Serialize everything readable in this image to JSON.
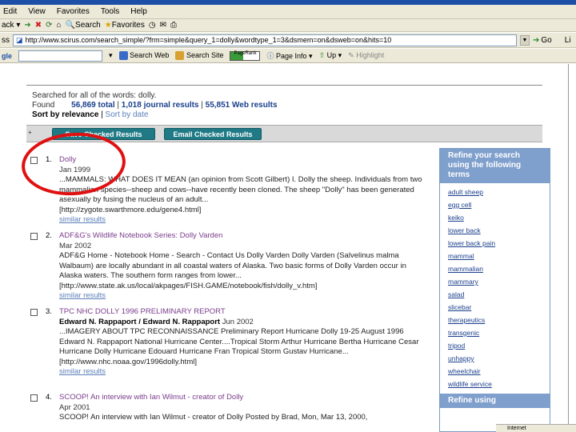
{
  "menu": {
    "items": [
      "Edit",
      "View",
      "Favorites",
      "Tools",
      "Help"
    ]
  },
  "toolbar": {
    "back_label": "ack",
    "search_label": "Search",
    "favorites_label": "Favorites"
  },
  "address": {
    "label": "ss",
    "url": "http://www.scirus.com/search_simple/?frm=simple&query_1=dolly&wordtype_1=3&dsmem=on&dsweb=on&hits=10",
    "go_label": "Go",
    "links_label": "Li"
  },
  "googlebar": {
    "label": "gle",
    "search_web": "Search Web",
    "search_site": "Search Site",
    "pagerank": "PageRank",
    "page_info": "Page Info",
    "up": "Up",
    "highlight": "Highlight"
  },
  "summary": {
    "searched_for": "Searched for all of the words: dolly.",
    "found_prefix": "Found",
    "total": "56,869 total",
    "journal": "1,018 journal results",
    "web": "55,851 Web results",
    "sort_prefix": "Sort by relevance",
    "sort_date": "Sort by date"
  },
  "actions": {
    "marker": "+",
    "save_checked": "Save Checked Results",
    "email_checked": "Email Checked Results"
  },
  "results": [
    {
      "num": "1.",
      "title": "Dolly",
      "date": "Jan 1999",
      "snippet": "...MAMMALS: WHAT DOES IT MEAN (an opinion from Scott Gilbert) I. Dolly the sheep. Individuals from two mammalian species--sheep and cows--have recently been cloned. The sheep \"Dolly\" has been generated asexually by fusing the nucleus of an adult...",
      "url": "[http://zygote.swarthmore.edu/gene4.html]",
      "similar": "similar results"
    },
    {
      "num": "2.",
      "title": "ADF&G's Wildlife Notebook Series: Dolly Varden",
      "date": "Mar 2002",
      "snippet": "ADF&G Home - Notebook Home - Search - Contact Us Dolly Varden Dolly Varden (Salvelinus malma Walbaum) are locally abundant in all coastal waters of Alaska. Two basic forms of Dolly Varden occur in Alaska waters. The southern form ranges from lower...",
      "url": "[http://www.state.ak.us/local/akpages/FISH.GAME/notebook/fish/dolly_v.htm]",
      "similar": "similar results"
    },
    {
      "num": "3.",
      "title": "TPC NHC DOLLY 1996 PRELIMINARY REPORT",
      "authors": "Edward N. Rappaport / Edward N. Rappaport",
      "date": "Jun 2002",
      "snippet": "...IMAGERY ABOUT TPC RECONNAISSANCE Preliminary Report Hurricane Dolly 19-25 August 1996 Edward N. Rappaport National Hurricane Center....Tropical Storm Arthur Hurricane Bertha Hurricane Cesar Hurricane Dolly Hurricane Edouard Hurricane Fran Tropical Storm Gustav Hurricane...",
      "url": "[http://www.nhc.noaa.gov/1996dolly.html]",
      "similar": "similar results"
    },
    {
      "num": "4.",
      "title": "SCOOP! An interview with Ian Wilmut - creator of Dolly",
      "date": "Apr 2001",
      "snippet": "SCOOP! An interview with Ian Wilmut - creator of Dolly Posted by Brad, Mon, Mar 13, 2000,"
    }
  ],
  "refine": {
    "heading": "Refine your search using the following terms",
    "terms": [
      "adult sheep",
      "egg cell",
      "keiko",
      "lower back",
      "lower back pain",
      "mammal",
      "mammalian",
      "mammary",
      "salad",
      "slicebar",
      "therapeutics",
      "transgenic",
      "tripod",
      "unhappy",
      "wheelchair",
      "wildlife service"
    ],
    "heading2": "Refine using"
  },
  "status": {
    "text": "Internet"
  },
  "colors": {
    "annotation_circle": "#e01010",
    "button_teal": "#1f7a86",
    "refine_header": "#7f9fcc",
    "link_blue": "#1a3f8c",
    "visited_title": "#7a3c8c"
  }
}
